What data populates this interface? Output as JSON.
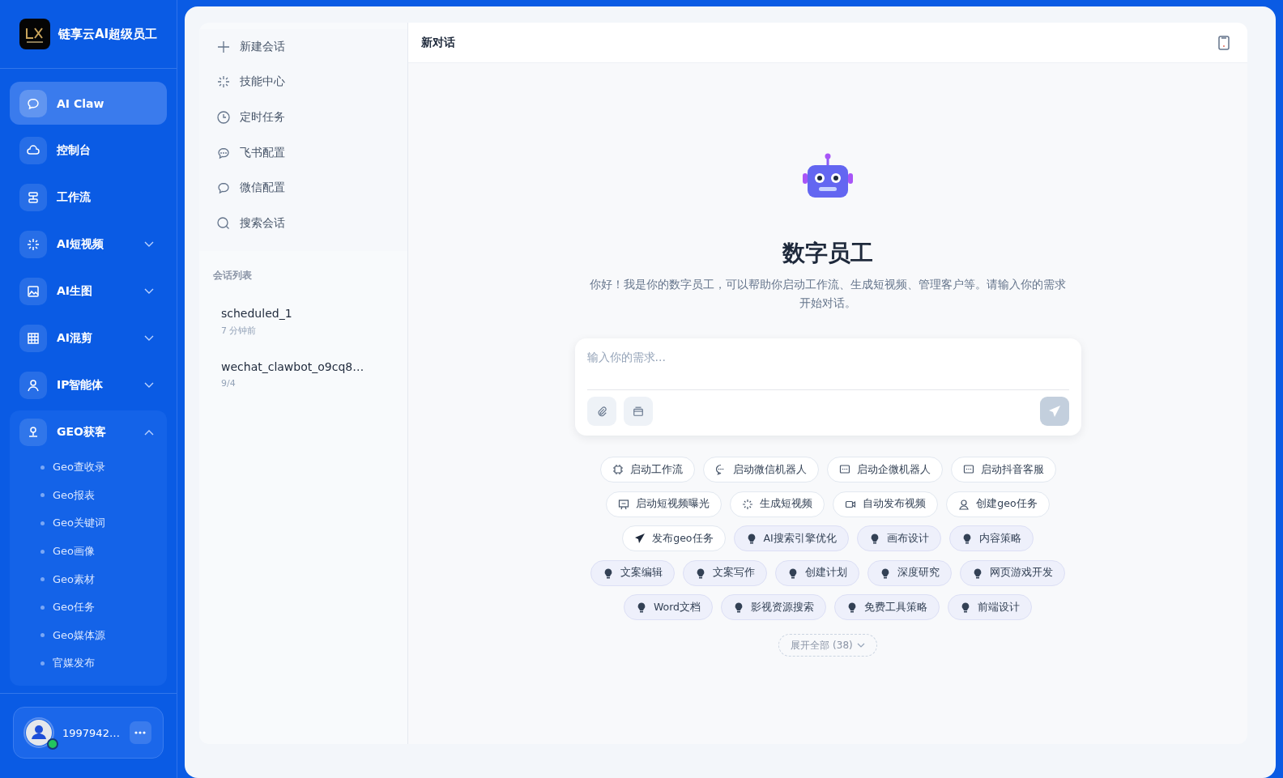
{
  "brand": {
    "title": "链享云AI超级员工"
  },
  "sidebar": {
    "items": [
      {
        "kind": "link",
        "label": "AI Claw",
        "selected": true
      },
      {
        "kind": "link",
        "label": "控制台",
        "selected": false
      },
      {
        "kind": "link",
        "label": "工作流",
        "selected": false
      },
      {
        "kind": "group",
        "label": "AI短视频",
        "selected": false,
        "expanded": false
      },
      {
        "kind": "group",
        "label": "AI生图",
        "selected": false,
        "expanded": false
      },
      {
        "kind": "group",
        "label": "AI混剪",
        "selected": false,
        "expanded": false
      },
      {
        "kind": "group",
        "label": "IP智能体",
        "selected": false,
        "expanded": false
      },
      {
        "kind": "group",
        "label": "GEO获客",
        "selected": false,
        "expanded": true,
        "children": [
          {
            "label": "Geo查收录"
          },
          {
            "label": "Geo报表"
          },
          {
            "label": "Geo关键词"
          },
          {
            "label": "Geo画像"
          },
          {
            "label": "Geo素材"
          },
          {
            "label": "Geo任务"
          },
          {
            "label": "Geo媒体源"
          },
          {
            "label": "官媒发布"
          }
        ]
      }
    ]
  },
  "user": {
    "name": "1997942…",
    "online": true
  },
  "chat_menu": {
    "items": [
      {
        "label": "新建会话"
      },
      {
        "label": "技能中心"
      },
      {
        "label": "定时任务"
      },
      {
        "label": "飞书配置"
      },
      {
        "label": "微信配置"
      },
      {
        "label": "搜索会话"
      }
    ],
    "list_title": "会话列表",
    "conversations": [
      {
        "title": "scheduled_1",
        "time": "7 分钟前"
      },
      {
        "title": "wechat_clawbot_o9cq8…",
        "time": "9/4"
      }
    ]
  },
  "chat": {
    "title": "新对话",
    "heading": "数字员工",
    "intro": "你好！我是你的数字员工，可以帮助你启动工作流、生成短视频、管理客户等。请输入你的需求开始对话。",
    "input": {
      "placeholder": "输入你的需求..."
    },
    "chips": [
      {
        "kind": "action",
        "label": "启动工作流"
      },
      {
        "kind": "action",
        "label": "启动微信机器人"
      },
      {
        "kind": "action",
        "label": "启动企微机器人"
      },
      {
        "kind": "action",
        "label": "启动抖音客服"
      },
      {
        "kind": "action",
        "label": "启动短视频曝光"
      },
      {
        "kind": "action",
        "label": "生成短视频"
      },
      {
        "kind": "action",
        "label": "自动发布视频"
      },
      {
        "kind": "action",
        "label": "创建geo任务"
      },
      {
        "kind": "action",
        "label": "发布geo任务"
      },
      {
        "kind": "skill",
        "label": "AI搜索引擎优化"
      },
      {
        "kind": "skill",
        "label": "画布设计"
      },
      {
        "kind": "skill",
        "label": "内容策略"
      },
      {
        "kind": "skill",
        "label": "文案编辑"
      },
      {
        "kind": "skill",
        "label": "文案写作"
      },
      {
        "kind": "skill",
        "label": "创建计划"
      },
      {
        "kind": "skill",
        "label": "深度研究"
      },
      {
        "kind": "skill",
        "label": "网页游戏开发"
      },
      {
        "kind": "skill",
        "label": "Word文档"
      },
      {
        "kind": "skill",
        "label": "影视资源搜索"
      },
      {
        "kind": "skill",
        "label": "免费工具策略"
      },
      {
        "kind": "skill",
        "label": "前端设计"
      }
    ],
    "expand": "展开全部 (38)"
  }
}
